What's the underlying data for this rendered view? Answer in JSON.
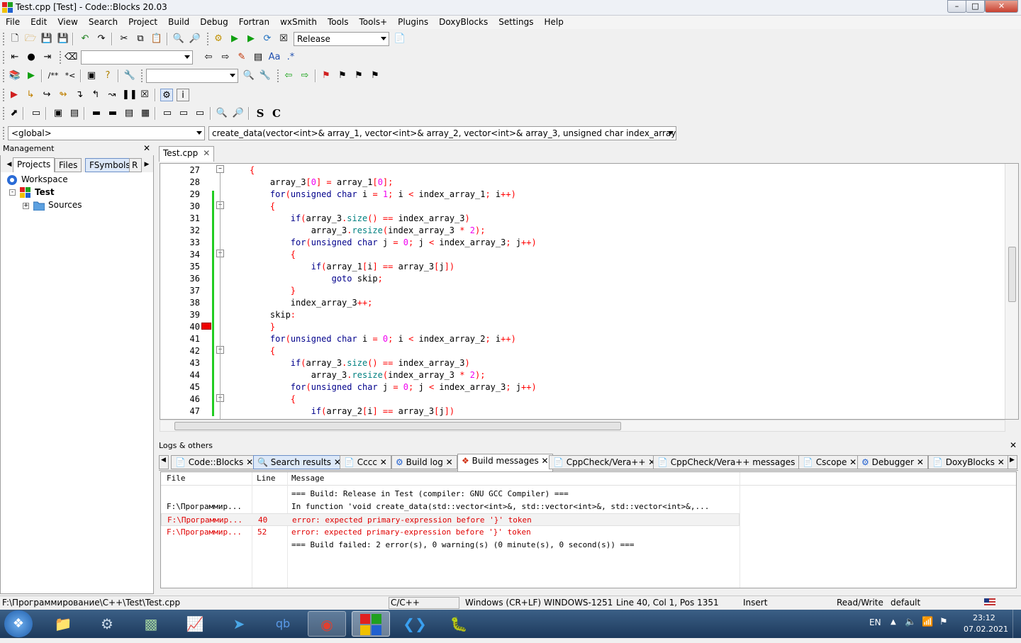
{
  "window": {
    "title": "Test.cpp [Test] - Code::Blocks 20.03",
    "minimize": "–",
    "maximize": "□",
    "close": "✕"
  },
  "menu": [
    "File",
    "Edit",
    "View",
    "Search",
    "Project",
    "Build",
    "Debug",
    "Fortran",
    "wxSmith",
    "Tools",
    "Tools+",
    "Plugins",
    "DoxyBlocks",
    "Settings",
    "Help"
  ],
  "toolbar": {
    "build_target": "Release",
    "scope": "<global>",
    "function": "create_data(vector<int>& array_1, vector<int>& array_2, vector<int>& array_3, unsigned char index_array_1, unsigned cl",
    "fmt_s": "S",
    "fmt_c": "C"
  },
  "management": {
    "title": "Management",
    "tabs": [
      "Projects",
      "Files",
      "FSymbols",
      "R"
    ],
    "tree": {
      "workspace": "Workspace",
      "project": "Test",
      "folder": "Sources"
    }
  },
  "editor": {
    "tab": "Test.cpp",
    "lines": [
      {
        "n": "27",
        "html": "<span class='op'>{</span>"
      },
      {
        "n": "28",
        "html": "    array_3<span class='op'>[</span><span class='num'>0</span><span class='op'>]</span> <span class='op'>=</span> array_1<span class='op'>[</span><span class='num'>0</span><span class='op'>];</span>"
      },
      {
        "n": "29",
        "html": "    <span class='kw'>for</span><span class='op'>(</span><span class='kw'>unsigned char</span> i <span class='op'>=</span> <span class='num'>1</span><span class='op'>;</span> i <span class='op'>&lt;</span> index_array_1<span class='op'>;</span> i<span class='op'>++)</span>"
      },
      {
        "n": "30",
        "html": "    <span class='op'>{</span>"
      },
      {
        "n": "31",
        "html": "        <span class='kw'>if</span><span class='op'>(</span>array_3<span class='op'>.</span><span class='fn'>size</span><span class='op'>()</span> <span class='op'>==</span> index_array_3<span class='op'>)</span>"
      },
      {
        "n": "32",
        "html": "            array_3<span class='op'>.</span><span class='fn'>resize</span><span class='op'>(</span>index_array_3 <span class='op'>*</span> <span class='num'>2</span><span class='op'>);</span>"
      },
      {
        "n": "33",
        "html": "        <span class='kw'>for</span><span class='op'>(</span><span class='kw'>unsigned char</span> j <span class='op'>=</span> <span class='num'>0</span><span class='op'>;</span> j <span class='op'>&lt;</span> index_array_3<span class='op'>;</span> j<span class='op'>++)</span>"
      },
      {
        "n": "34",
        "html": "        <span class='op'>{</span>"
      },
      {
        "n": "35",
        "html": "            <span class='kw'>if</span><span class='op'>(</span>array_1<span class='op'>[</span>i<span class='op'>]</span> <span class='op'>==</span> array_3<span class='op'>[</span>j<span class='op'>])</span>"
      },
      {
        "n": "36",
        "html": "                <span class='kw'>goto</span> skip<span class='op'>;</span>"
      },
      {
        "n": "37",
        "html": "        <span class='op'>}</span>"
      },
      {
        "n": "38",
        "html": "        index_array_3<span class='op'>++;</span>"
      },
      {
        "n": "39",
        "html": "    skip<span class='op'>:</span>"
      },
      {
        "n": "40",
        "html": "    <span class='op'>}</span>"
      },
      {
        "n": "41",
        "html": "    <span class='kw'>for</span><span class='op'>(</span><span class='kw'>unsigned char</span> i <span class='op'>=</span> <span class='num'>0</span><span class='op'>;</span> i <span class='op'>&lt;</span> index_array_2<span class='op'>;</span> i<span class='op'>++)</span>"
      },
      {
        "n": "42",
        "html": "    <span class='op'>{</span>"
      },
      {
        "n": "43",
        "html": "        <span class='kw'>if</span><span class='op'>(</span>array_3<span class='op'>.</span><span class='fn'>size</span><span class='op'>()</span> <span class='op'>==</span> index_array_3<span class='op'>)</span>"
      },
      {
        "n": "44",
        "html": "            array_3<span class='op'>.</span><span class='fn'>resize</span><span class='op'>(</span>index_array_3 <span class='op'>*</span> <span class='num'>2</span><span class='op'>);</span>"
      },
      {
        "n": "45",
        "html": "        <span class='kw'>for</span><span class='op'>(</span><span class='kw'>unsigned char</span> j <span class='op'>=</span> <span class='num'>0</span><span class='op'>;</span> j <span class='op'>&lt;</span> index_array_3<span class='op'>;</span> j<span class='op'>++)</span>"
      },
      {
        "n": "46",
        "html": "        <span class='op'>{</span>"
      },
      {
        "n": "47",
        "html": "            <span class='kw'>if</span><span class='op'>(</span>array_2<span class='op'>[</span>i<span class='op'>]</span> <span class='op'>==</span> array_3<span class='op'>[</span>j<span class='op'>])</span>"
      }
    ]
  },
  "logs": {
    "title": "Logs & others",
    "tabs": [
      "Code::Blocks",
      "Search results",
      "Cccc",
      "Build log",
      "Build messages",
      "CppCheck/Vera++",
      "CppCheck/Vera++ messages",
      "Cscope",
      "Debugger",
      "DoxyBlocks"
    ],
    "columns": [
      "File",
      "Line",
      "Message"
    ],
    "rows": [
      {
        "file": "",
        "line": "",
        "msg": "=== Build: Release in Test (compiler: GNU GCC Compiler) ===",
        "err": false
      },
      {
        "file": "F:\\Программир...",
        "line": "",
        "msg": "In function 'void create_data(std::vector<int>&, std::vector<int>&, std::vector<int>&,...",
        "err": false
      },
      {
        "file": "F:\\Программир...",
        "line": "40",
        "msg": "error: expected primary-expression before '}' token",
        "err": true
      },
      {
        "file": "F:\\Программир...",
        "line": "52",
        "msg": "error: expected primary-expression before '}' token",
        "err": true
      },
      {
        "file": "",
        "line": "",
        "msg": "=== Build failed: 2 error(s), 0 warning(s) (0 minute(s), 0 second(s)) ===",
        "err": false
      }
    ]
  },
  "status": {
    "path": "F:\\Программирование\\C++\\Test\\Test.cpp",
    "lang": "C/C++",
    "eol": "Windows (CR+LF)",
    "enc": "WINDOWS-1251",
    "pos": "Line 40, Col 1, Pos 1351",
    "mode": "Insert",
    "rw": "Read/Write",
    "profile": "default"
  },
  "taskbar": {
    "lang": "EN",
    "time": "23:12",
    "date": "07.02.2021"
  }
}
